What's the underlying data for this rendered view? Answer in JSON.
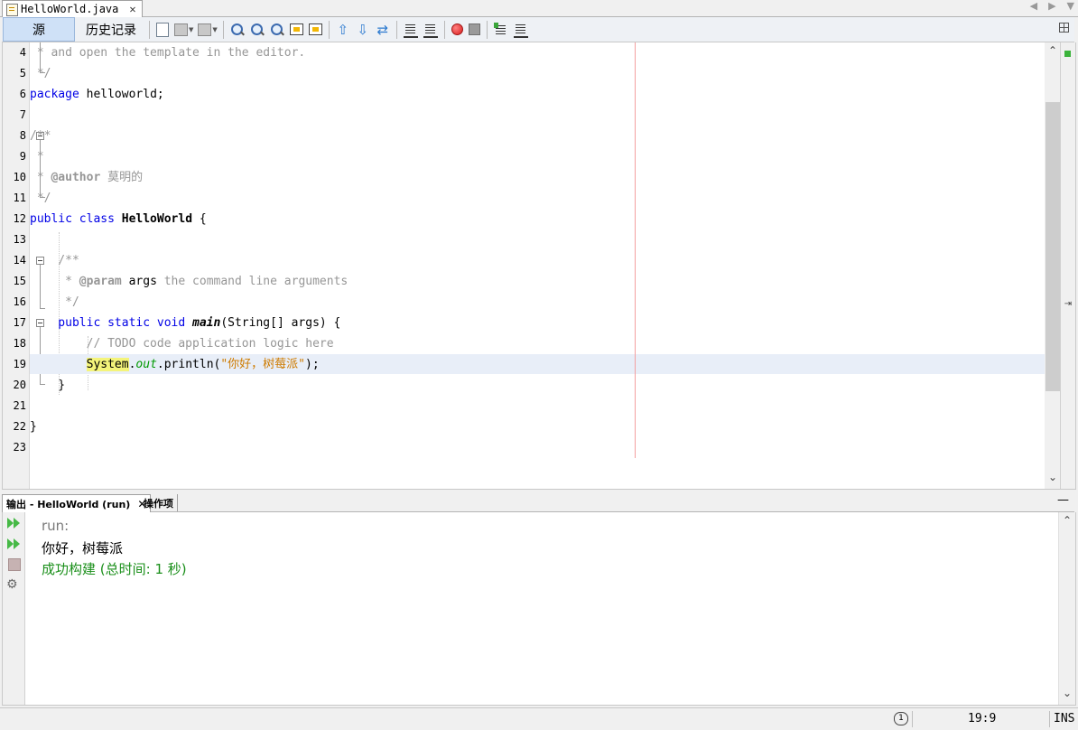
{
  "editor_tab": {
    "title": "HelloWorld.java",
    "close": "✕"
  },
  "tab_nav": {
    "prev": "◀",
    "next": "▶",
    "menu": "▼"
  },
  "toolbar": {
    "source_label": "源",
    "history_label": "历史记录"
  },
  "editor": {
    "line_numbers": [
      "4",
      "5",
      "6",
      "7",
      "8",
      "9",
      "10",
      "11",
      "12",
      "13",
      "14",
      "15",
      "16",
      "17",
      "18",
      "19",
      "20",
      "21",
      "22",
      "23"
    ],
    "scroll_up": "⌃",
    "scroll_down": "⌄",
    "split_marker": "⇥"
  },
  "code": {
    "l4": " * and open the template in the editor.",
    "l5": " */",
    "l6_kw": "package",
    "l6_rest": " helloworld;",
    "l8": "/**",
    "l9": " *",
    "l10_star": " * ",
    "l10_tag": "@author",
    "l10_name": " 莫明的",
    "l11": " */",
    "l12_kw": "public class",
    "l12_name": " HelloWorld",
    "l12_brace": " {",
    "l14": "    /**",
    "l15_star": "     * ",
    "l15_tag": "@param",
    "l15_arg": " args",
    "l15_desc": " the command line arguments",
    "l16": "     */",
    "l17_kw": "    public static void",
    "l17_main": " main",
    "l17_rest": "(String[] args) {",
    "l18": "        // TODO code application logic here",
    "l19_indent": "        ",
    "l19_sys": "System",
    "l19_dot": ".",
    "l19_out": "out",
    "l19_call": ".println(",
    "l19_str": "\"你好，树莓派\"",
    "l19_end": ");",
    "l20": "    }",
    "l22": "}"
  },
  "output": {
    "tab_label": "输出 - HelloWorld (run)",
    "tab_close": "✕",
    "tasks_label": "操作项",
    "minimize": "—",
    "lines": [
      "run:",
      "你好，树莓派",
      "成功构建 (总时间: 1 秒)"
    ],
    "settings_glyph": "⚙"
  },
  "status": {
    "notifications": "1",
    "position": "19:9",
    "mode": "INS"
  },
  "colors": {
    "success": "#1a8f1a",
    "run_text": "#7a7a7a",
    "keyword": "#0000e6",
    "comment": "#969696"
  }
}
